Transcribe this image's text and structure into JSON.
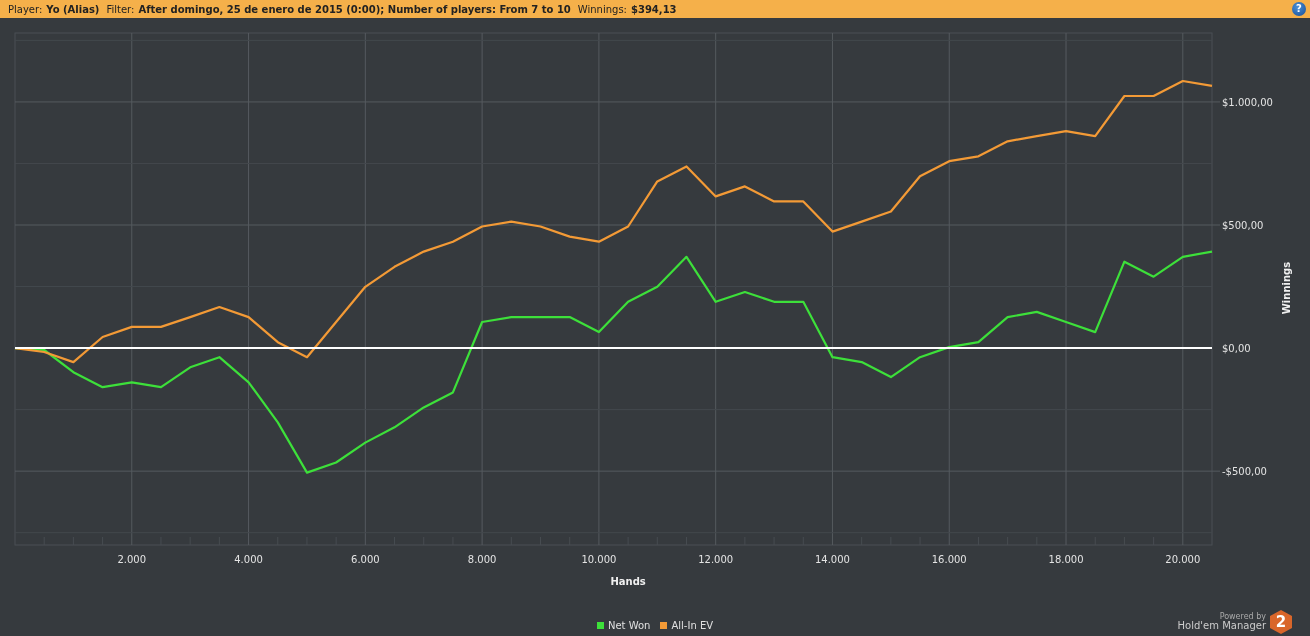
{
  "header": {
    "fields": [
      {
        "label": "Player:",
        "value": "Yo (Alias)"
      },
      {
        "label": "Filter:",
        "value": "After domingo, 25 de enero de 2015 (0:00); Number of players: From 7 to 10"
      },
      {
        "label": "Winnings:",
        "value": "$394,13"
      }
    ],
    "help": "?"
  },
  "chart": {
    "chart_data": {
      "type": "line",
      "grid": true,
      "xlabel": "Hands",
      "ylabel": "Winnings",
      "xlim": [
        0,
        20500
      ],
      "ylim": [
        -800,
        1280
      ],
      "xticks": [
        {
          "value": 2000,
          "label": "2.000"
        },
        {
          "value": 4000,
          "label": "4.000"
        },
        {
          "value": 6000,
          "label": "6.000"
        },
        {
          "value": 8000,
          "label": "8.000"
        },
        {
          "value": 10000,
          "label": "10.000"
        },
        {
          "value": 12000,
          "label": "12.000"
        },
        {
          "value": 14000,
          "label": "14.000"
        },
        {
          "value": 16000,
          "label": "16.000"
        },
        {
          "value": 18000,
          "label": "18.000"
        },
        {
          "value": 20000,
          "label": "20.000"
        }
      ],
      "yticks": [
        {
          "value": -500,
          "label": "-$500,00"
        },
        {
          "value": 0,
          "label": "$0,00"
        },
        {
          "value": 500,
          "label": "$500,00"
        },
        {
          "value": 1000,
          "label": "$1.000,00"
        }
      ],
      "x": [
        0,
        500,
        1000,
        1500,
        2000,
        2500,
        3000,
        3500,
        4000,
        4500,
        5000,
        5500,
        6000,
        6500,
        7000,
        7500,
        8000,
        8500,
        9000,
        9500,
        10000,
        10500,
        11000,
        11500,
        12000,
        12500,
        13000,
        13500,
        14000,
        14500,
        15000,
        15500,
        16000,
        16500,
        17000,
        17500,
        18000,
        18500,
        19000,
        19500,
        20000,
        20500
      ],
      "series": [
        {
          "name": "Net Won",
          "color": "#3de03a",
          "values": [
            0,
            -8,
            -98,
            -159,
            -139,
            -159,
            -78,
            -37,
            -139,
            -302,
            -506,
            -465,
            -384,
            -322,
            -241,
            -180,
            106,
            126,
            126,
            126,
            65,
            188,
            249,
            371,
            188,
            228,
            188,
            188,
            -37,
            -57,
            -118,
            -37,
            4,
            24,
            126,
            147,
            106,
            65,
            351,
            290,
            371,
            392
          ]
        },
        {
          "name": "All-In EV",
          "color": "#f39a36",
          "values": [
            0,
            -16,
            -57,
            45,
            86,
            86,
            126,
            167,
            126,
            24,
            -37,
            106,
            249,
            330,
            392,
            432,
            494,
            514,
            494,
            453,
            432,
            494,
            677,
            738,
            616,
            657,
            596,
            596,
            473,
            514,
            555,
            698,
            759,
            779,
            840,
            861,
            881,
            861,
            1024,
            1024,
            1085,
            1065
          ]
        }
      ]
    }
  },
  "branding": {
    "powered_by": "Powered by",
    "name": "Hold'em Manager",
    "badge": "2"
  }
}
